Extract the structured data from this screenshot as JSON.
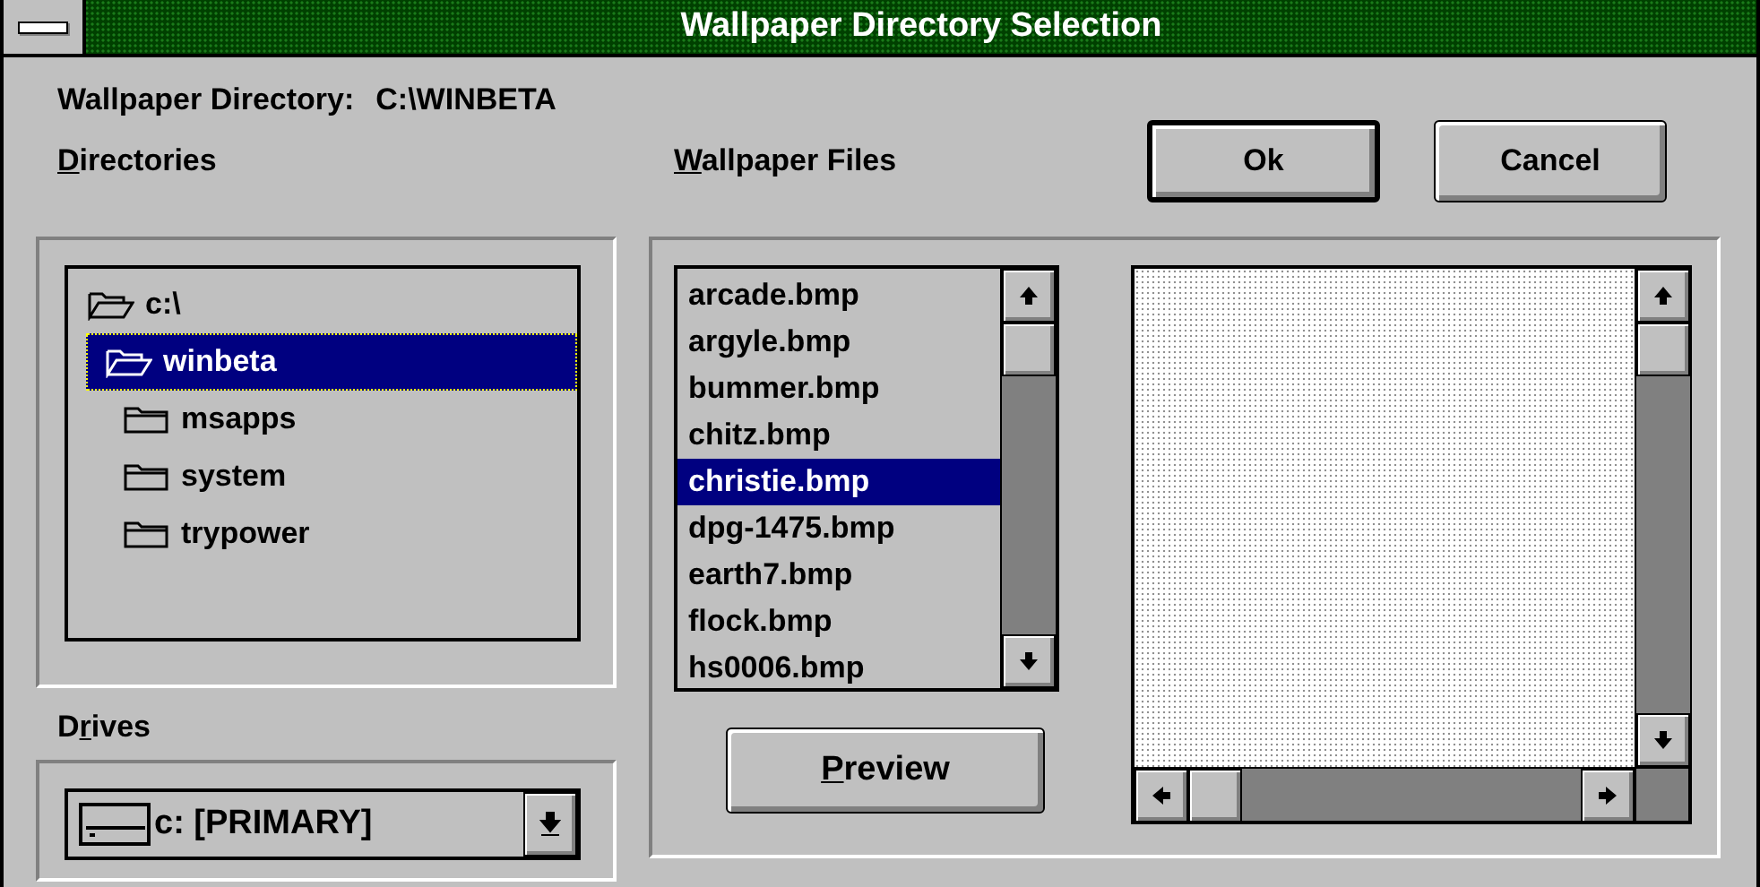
{
  "window": {
    "title": "Wallpaper Directory Selection"
  },
  "directory_path": {
    "label": "Wallpaper Directory:",
    "value": "C:\\WINBETA"
  },
  "buttons": [
    {
      "label": "Ok",
      "default": true
    },
    {
      "label": "Cancel",
      "default": false
    }
  ],
  "directories": {
    "label": [
      {
        "text": "D",
        "underlined": true
      },
      {
        "text": "irectories",
        "underlined": false
      }
    ],
    "tree": [
      {
        "name": "c:\\",
        "expanded": true,
        "selected": false,
        "children": [
          {
            "name": "winbeta",
            "expanded": true,
            "selected": true,
            "children": [
              {
                "name": "msapps",
                "expanded": false,
                "selected": false
              },
              {
                "name": "system",
                "expanded": false,
                "selected": false
              },
              {
                "name": "trypower",
                "expanded": false,
                "selected": false
              }
            ]
          }
        ]
      }
    ]
  },
  "drives": {
    "label": [
      {
        "text": "D",
        "underlined": false
      },
      {
        "text": "r",
        "underlined": true
      },
      {
        "text": "ives",
        "underlined": false
      }
    ],
    "value": "c: [PRIMARY]"
  },
  "wallpaper_files": {
    "label": [
      {
        "text": "W",
        "underlined": true
      },
      {
        "text": "allpaper Files",
        "underlined": false
      }
    ],
    "items": [
      {
        "name": "arcade.bmp",
        "selected": false
      },
      {
        "name": "argyle.bmp",
        "selected": false
      },
      {
        "name": "bummer.bmp",
        "selected": false
      },
      {
        "name": "chitz.bmp",
        "selected": false
      },
      {
        "name": "christie.bmp",
        "selected": true
      },
      {
        "name": "dpg-1475.bmp",
        "selected": false
      },
      {
        "name": "earth7.bmp",
        "selected": false
      },
      {
        "name": "flock.bmp",
        "selected": false
      },
      {
        "name": "hs0006.bmp",
        "selected": false
      }
    ]
  },
  "preview_button": {
    "label": [
      {
        "text": "P",
        "underlined": true
      },
      {
        "text": "review",
        "underlined": false
      }
    ]
  }
}
